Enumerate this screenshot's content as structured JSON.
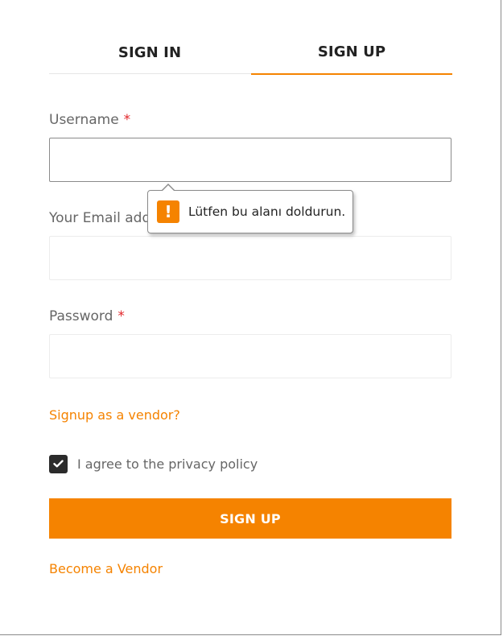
{
  "tabs": [
    {
      "label": "SIGN IN",
      "active": false
    },
    {
      "label": "SIGN UP",
      "active": true
    }
  ],
  "form": {
    "username": {
      "label": "Username",
      "required_mark": "*",
      "value": "",
      "placeholder": ""
    },
    "email": {
      "label": "Your Email address",
      "required_mark": "*",
      "value": "",
      "placeholder": ""
    },
    "password": {
      "label": "Password",
      "required_mark": "*",
      "value": "",
      "placeholder": ""
    }
  },
  "validation_tooltip": {
    "icon": "warning-icon",
    "icon_glyph": "!",
    "message": "Lütfen bu alanı doldurun."
  },
  "vendor_signup_link": "Signup as a vendor?",
  "privacy": {
    "checked": true,
    "label": "I agree to the privacy policy"
  },
  "submit_label": "SIGN UP",
  "become_vendor_link": "Become a Vendor",
  "colors": {
    "accent": "#f58300",
    "required": "#e2262a",
    "text_muted": "#666666",
    "checkbox_bg": "#2b2b2b"
  }
}
